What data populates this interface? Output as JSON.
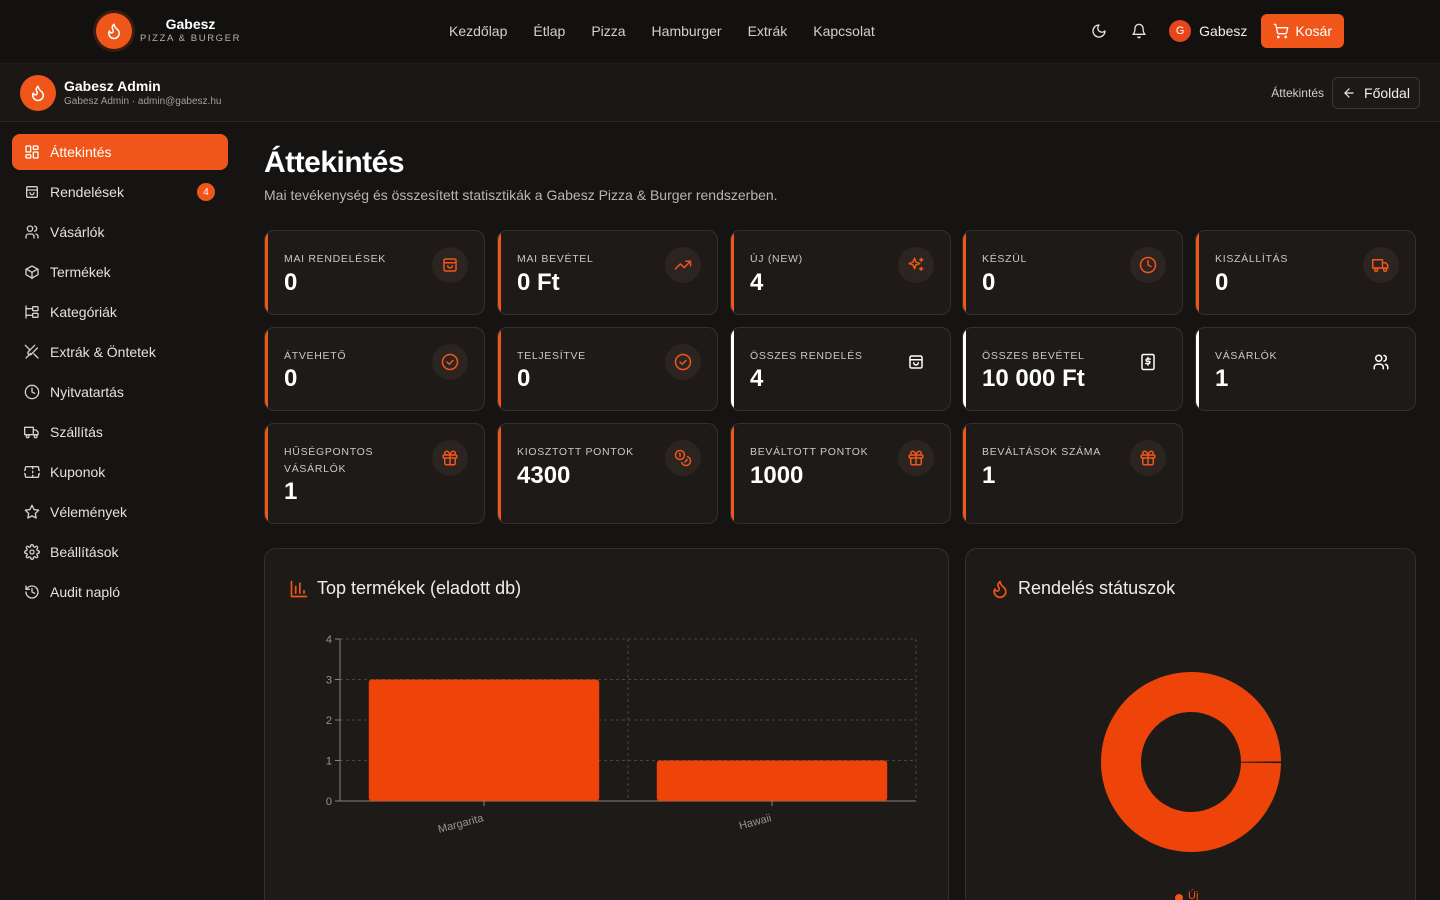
{
  "nav": {
    "brand_name": "Gabesz",
    "brand_sub": "PIZZA & BURGER",
    "links": [
      "Kezdőlap",
      "Étlap",
      "Pizza",
      "Hamburger",
      "Extrák",
      "Kapcsolat"
    ],
    "user_initial": "G",
    "user_name": "Gabesz",
    "cart_label": "Kosár",
    "icons": [
      "moon-icon",
      "bell-icon",
      "cart-icon"
    ]
  },
  "admin": {
    "name": "Gabesz Admin",
    "sub": "Gabesz Admin · admin@gabesz.hu",
    "breadcrumb": "Áttekintés",
    "home_label": "Főoldal"
  },
  "sidebar": {
    "items": [
      {
        "label": "Áttekintés",
        "icon": "dashboard-icon",
        "active": true
      },
      {
        "label": "Rendelések",
        "icon": "bag-icon",
        "badge": "4"
      },
      {
        "label": "Vásárlók",
        "icon": "users-icon"
      },
      {
        "label": "Termékek",
        "icon": "box-icon"
      },
      {
        "label": "Kategóriák",
        "icon": "tree-icon"
      },
      {
        "label": "Extrák & Öntetek",
        "icon": "utensils-icon"
      },
      {
        "label": "Nyitvatartás",
        "icon": "clock-icon"
      },
      {
        "label": "Szállítás",
        "icon": "truck-icon"
      },
      {
        "label": "Kuponok",
        "icon": "ticket-icon"
      },
      {
        "label": "Vélemények",
        "icon": "star-icon"
      },
      {
        "label": "Beállítások",
        "icon": "gear-icon"
      },
      {
        "label": "Audit napló",
        "icon": "history-icon"
      }
    ]
  },
  "main": {
    "title": "Áttekintés",
    "subtitle": "Mai tevékenység és összesített statisztikák a Gabesz Pizza & Burger rendszerben."
  },
  "cards": [
    {
      "label": "Mai rendelések",
      "value": "0",
      "icon": "bag-icon",
      "accent": "#f0561a"
    },
    {
      "label": "Mai bevétel",
      "value": "0 Ft",
      "icon": "trending-up-icon",
      "accent": "#f0561a"
    },
    {
      "label": "Új (new)",
      "value": "4",
      "icon": "sparkles-icon",
      "accent": "#f0561a"
    },
    {
      "label": "Készül",
      "value": "0",
      "icon": "clock-icon",
      "accent": "#f0561a"
    },
    {
      "label": "Kiszállítás",
      "value": "0",
      "icon": "truck-icon",
      "accent": "#f0561a"
    },
    {
      "label": "Átvehető",
      "value": "0",
      "icon": "check-circle-icon",
      "accent": "#f0561a"
    },
    {
      "label": "Teljesítve",
      "value": "0",
      "icon": "check-circle-icon",
      "accent": "#f0561a"
    },
    {
      "label": "Összes rendelés",
      "value": "4",
      "icon": "bag-icon",
      "accent": "#ffffff"
    },
    {
      "label": "Összes bevétel",
      "value": "10 000 Ft",
      "icon": "receipt-icon",
      "accent": "#ffffff"
    },
    {
      "label": "Vásárlók",
      "value": "1",
      "icon": "users-icon",
      "accent": "#ffffff"
    },
    {
      "label": "Hűségpontos vásárlók",
      "value": "1",
      "icon": "gift-icon",
      "accent": "#f0561a"
    },
    {
      "label": "Kiosztott pontok",
      "value": "4300",
      "icon": "coins-icon",
      "accent": "#f0561a"
    },
    {
      "label": "Beváltott pontok",
      "value": "1000",
      "icon": "gift-icon",
      "accent": "#f0561a"
    },
    {
      "label": "Beváltások száma",
      "value": "1",
      "icon": "gift-icon",
      "accent": "#f0561a"
    }
  ],
  "panels": {
    "top_title": "Top termékek (eladott db)",
    "status_title": "Rendelés státuszok"
  },
  "chart_data": [
    {
      "type": "bar",
      "title": "Top termékek (eladott db)",
      "categories": [
        "Margarita",
        "Hawaii"
      ],
      "values": [
        3,
        1
      ],
      "ylim": [
        0,
        4
      ],
      "yticks": [
        "0",
        "1",
        "2",
        "3",
        "4"
      ],
      "grid": true,
      "color": "#ee4409"
    },
    {
      "type": "pie",
      "title": "Rendelés státuszok",
      "labels": [
        "Új"
      ],
      "values": [
        4
      ],
      "donut": true,
      "color": "#ee4409",
      "legend": "bottom"
    }
  ]
}
